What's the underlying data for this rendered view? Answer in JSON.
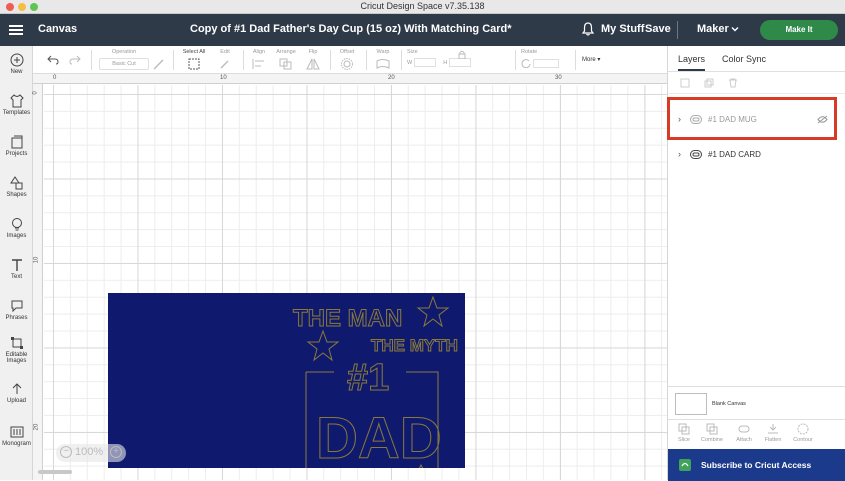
{
  "window": {
    "title": "Cricut Design Space  v7.35.138"
  },
  "topbar": {
    "menu_icon": "hamburger-icon",
    "section": "Canvas",
    "project_title": "Copy of #1 Dad Father's Day Cup (15 oz) With Matching Card*",
    "my_stuff": "My Stuff",
    "save": "Save",
    "machine": "Maker",
    "make_it": "Make It",
    "colors": {
      "bar": "#2f3a48",
      "make_it": "#2f8a4a"
    }
  },
  "leftnav": [
    {
      "label": "New",
      "icon": "plus-circle-icon"
    },
    {
      "label": "Templates",
      "icon": "shirt-icon"
    },
    {
      "label": "Projects",
      "icon": "projects-icon"
    },
    {
      "label": "Shapes",
      "icon": "shapes-icon"
    },
    {
      "label": "Images",
      "icon": "bulb-icon"
    },
    {
      "label": "Text",
      "icon": "text-icon"
    },
    {
      "label": "Phrases",
      "icon": "chat-icon"
    },
    {
      "label": "Editable Images",
      "icon": "editable-images-icon"
    },
    {
      "label": "Upload",
      "icon": "upload-icon"
    },
    {
      "label": "Monogram",
      "icon": "monogram-icon"
    }
  ],
  "toolbar": {
    "operation_label": "Operation",
    "operation_value": "Basic Cut",
    "select_all": "Select All",
    "edit": "Edit",
    "align": "Align",
    "arrange": "Arrange",
    "flip": "Flip",
    "offset": "Offset",
    "warp": "Warp",
    "size": "Size",
    "w": "W",
    "h": "H",
    "rotate": "Rotate",
    "more": "More"
  },
  "rulers": {
    "top": [
      "0",
      "10",
      "20",
      "30"
    ],
    "left": [
      "0",
      "10",
      "20"
    ]
  },
  "canvas": {
    "zoom": "100%",
    "design_lines": [
      "THE MAN",
      "THE MYTH",
      "#1",
      "DAD"
    ],
    "colors": {
      "design_bg": "#0f1a6e",
      "outline": "#8a7a3a"
    }
  },
  "right_panel": {
    "tabs": [
      "Layers",
      "Color Sync"
    ],
    "layers": [
      {
        "name": "#1 DAD MUG",
        "hidden": true
      },
      {
        "name": "#1 DAD CARD",
        "hidden": false
      }
    ],
    "blank_canvas": "Blank Canvas",
    "layer_tools": [
      "Slice",
      "Combine",
      "Attach",
      "Flatten",
      "Contour"
    ],
    "subscribe": "Subscribe to Cricut Access",
    "highlight_color": "#d93a26"
  }
}
